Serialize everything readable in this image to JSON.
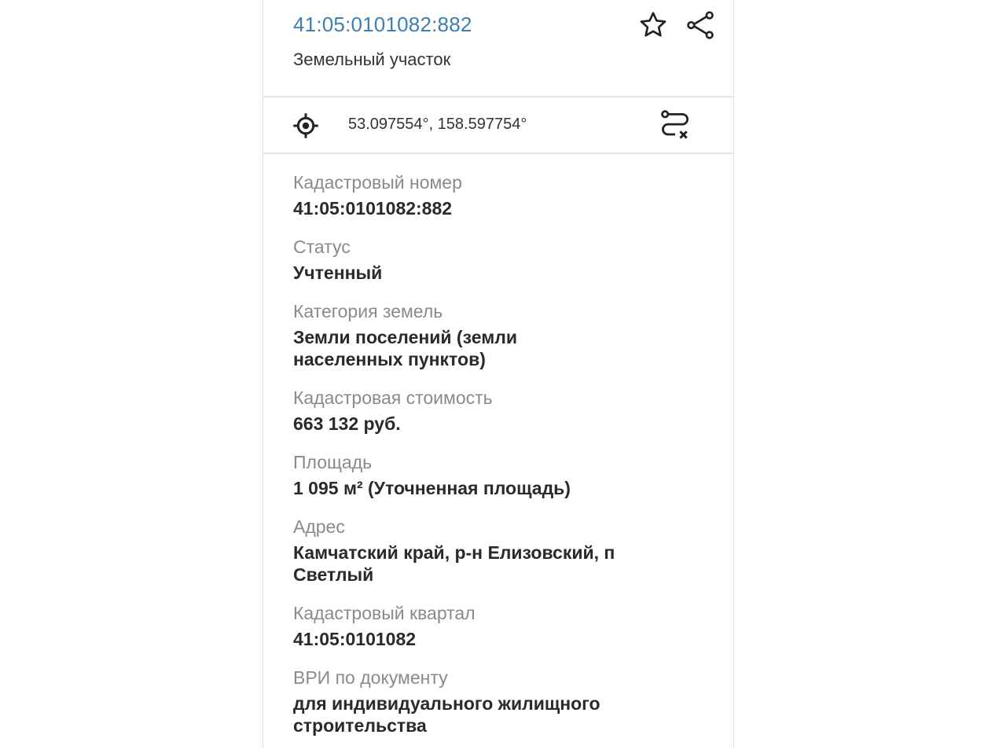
{
  "header": {
    "cadastral_link": "41:05:0101082:882",
    "object_type": "Земельный участок",
    "star_icon": "star-outline-icon",
    "share_icon": "share-icon"
  },
  "coordinates": {
    "text": "53.097554°, 158.597754°",
    "target_icon": "crosshair-icon",
    "route_icon": "route-clear-icon"
  },
  "fields": [
    {
      "label": "Кадастровый номер",
      "value": "41:05:0101082:882"
    },
    {
      "label": "Статус",
      "value": "Учтенный"
    },
    {
      "label": "Категория земель",
      "value": "Земли поселений (земли населенных пунктов)"
    },
    {
      "label": "Кадастровая стоимость",
      "value": "663 132 руб."
    },
    {
      "label": "Площадь",
      "value": "1 095 м² (Уточненная площадь)"
    },
    {
      "label": "Адрес",
      "value": "Камчатский край, р-н Елизовский, п Светлый"
    },
    {
      "label": "Кадастровый квартал",
      "value": "41:05:0101082"
    },
    {
      "label": "ВРИ по документу",
      "value": "для индивидуального жилищного строительства"
    }
  ],
  "colors": {
    "link": "#3d7fb0",
    "label": "#8a8a8a",
    "value": "#2a2a2a",
    "divider": "#e4e4e4"
  }
}
